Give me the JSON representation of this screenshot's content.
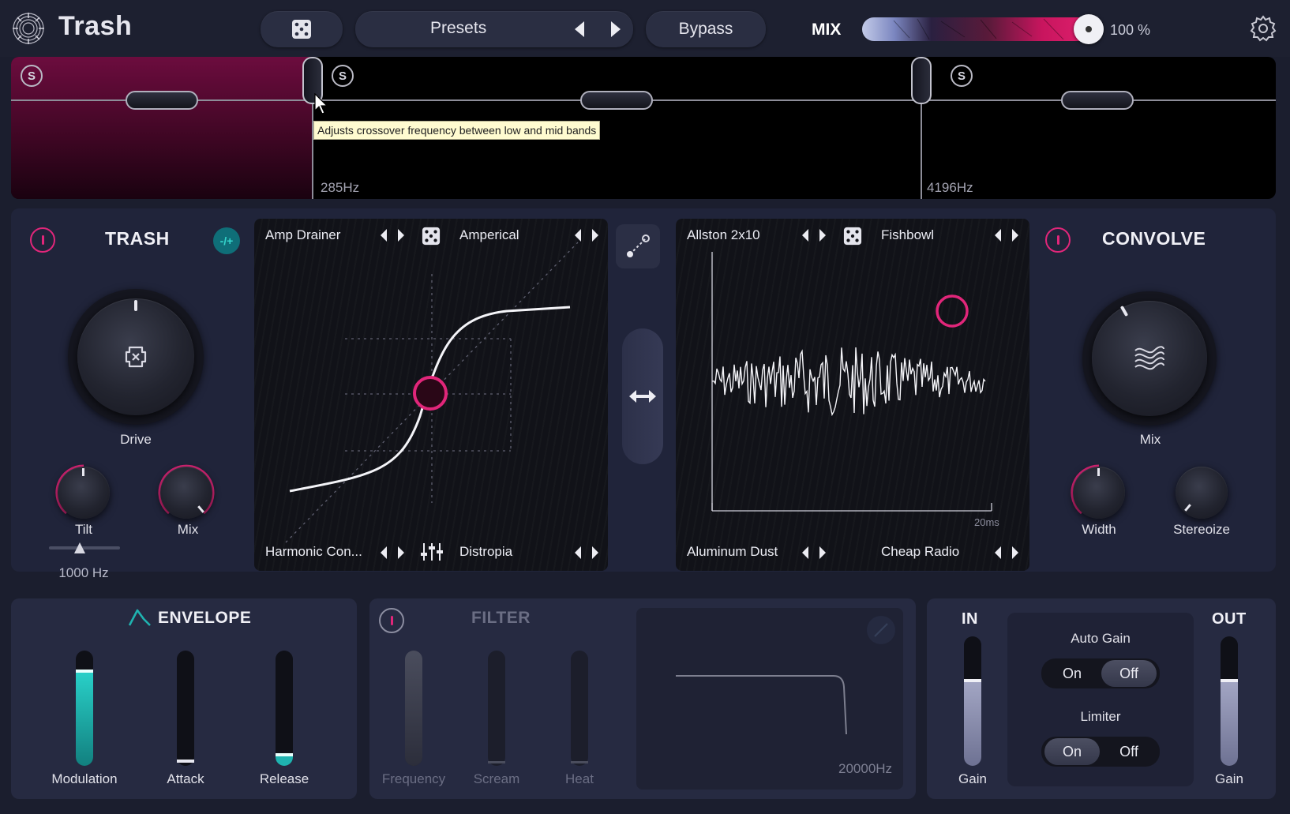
{
  "app": {
    "title": "Trash"
  },
  "toolbar": {
    "presets_label": "Presets",
    "bypass_label": "Bypass",
    "mix_label": "MIX",
    "mix_value_text": "100 %",
    "mix_level": 1.0
  },
  "bands": {
    "solo_label": "S",
    "crossover_low": "285Hz",
    "crossover_high": "4196Hz",
    "tooltip": "Adjusts crossover frequency between low and mid bands"
  },
  "trash_module": {
    "title": "TRASH",
    "polarity": "-/+",
    "drive_label": "Drive",
    "tilt_label": "Tilt",
    "mix_label": "Mix",
    "tilt_freq": "1000 Hz"
  },
  "distortion_screen": {
    "top_left": "Amp Drainer",
    "top_right": "Amperical",
    "bottom_left": "Harmonic Con...",
    "bottom_right": "Distropia"
  },
  "convolve_screen": {
    "top_left": "Allston 2x10",
    "top_right": "Fishbowl",
    "bottom_left": "Aluminum Dust",
    "bottom_right": "Cheap Radio",
    "time_label": "20ms"
  },
  "convolve_module": {
    "title": "CONVOLVE",
    "mix_label": "Mix",
    "width_label": "Width",
    "stereoize_label": "Stereoize"
  },
  "envelope": {
    "title": "ENVELOPE",
    "modulation_label": "Modulation",
    "attack_label": "Attack",
    "release_label": "Release"
  },
  "filter": {
    "title": "FILTER",
    "frequency_label": "Frequency",
    "scream_label": "Scream",
    "heat_label": "Heat",
    "freq_value": "20000Hz"
  },
  "io": {
    "in_label": "IN",
    "out_label": "OUT",
    "in_gain_label": "Gain",
    "out_gain_label": "Gain",
    "auto_gain_label": "Auto Gain",
    "limiter_label": "Limiter",
    "on_label": "On",
    "off_label": "Off"
  },
  "colors": {
    "accent": "#e1267a",
    "teal": "#1fb3b0",
    "panel": "#20243a"
  }
}
